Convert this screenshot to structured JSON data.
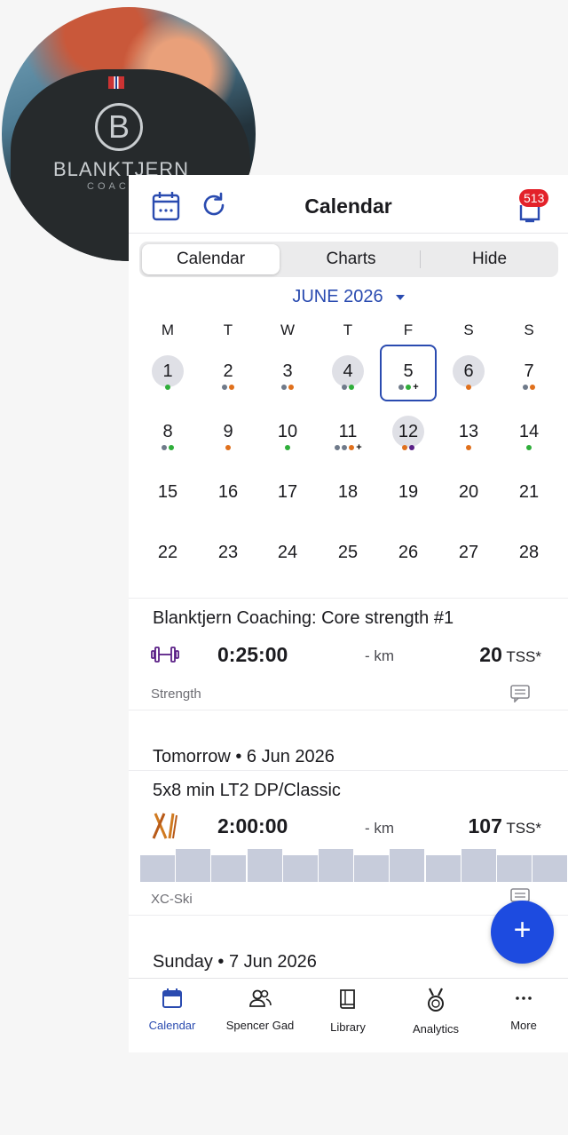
{
  "photo": {
    "brand": "BLANKTJERN",
    "brand_sub": "COACHING",
    "logo_letter": "B"
  },
  "header": {
    "title": "Calendar",
    "notification_count": "513",
    "icons": [
      "calendar-icon",
      "refresh-icon",
      "tray-icon"
    ]
  },
  "segments": [
    {
      "label": "Calendar",
      "active": true
    },
    {
      "label": "Charts",
      "active": false
    },
    {
      "label": "Hide",
      "active": false
    }
  ],
  "month": {
    "label": "JUNE 2026"
  },
  "weekdays": [
    "M",
    "T",
    "W",
    "T",
    "F",
    "S",
    "S"
  ],
  "dot_colors": {
    "gray": "#6f7a8a",
    "green": "#2fae3a",
    "orange": "#e0701c",
    "purple": "#5a1f86"
  },
  "weeks": [
    [
      {
        "d": "1",
        "sel": true,
        "dots": [
          "green"
        ]
      },
      {
        "d": "2",
        "dots": [
          "gray",
          "orange"
        ]
      },
      {
        "d": "3",
        "dots": [
          "gray",
          "orange"
        ]
      },
      {
        "d": "4",
        "sel": true,
        "dots": [
          "gray",
          "green"
        ]
      },
      {
        "d": "5",
        "today": true,
        "dots": [
          "gray",
          "green"
        ],
        "plus": true
      },
      {
        "d": "6",
        "sel": true,
        "dots": [
          "orange"
        ]
      },
      {
        "d": "7",
        "dots": [
          "gray",
          "orange"
        ]
      }
    ],
    [
      {
        "d": "8",
        "dots": [
          "gray",
          "green"
        ]
      },
      {
        "d": "9",
        "dots": [
          "orange"
        ]
      },
      {
        "d": "10",
        "dots": [
          "green"
        ]
      },
      {
        "d": "11",
        "dots": [
          "gray",
          "gray",
          "orange"
        ],
        "plus": true
      },
      {
        "d": "12",
        "sel": true,
        "dots": [
          "orange",
          "purple"
        ]
      },
      {
        "d": "13",
        "dots": [
          "orange"
        ]
      },
      {
        "d": "14",
        "dots": [
          "green"
        ]
      }
    ],
    [
      {
        "d": "15"
      },
      {
        "d": "16"
      },
      {
        "d": "17"
      },
      {
        "d": "18"
      },
      {
        "d": "19"
      },
      {
        "d": "20"
      },
      {
        "d": "21"
      }
    ],
    [
      {
        "d": "22"
      },
      {
        "d": "23"
      },
      {
        "d": "24"
      },
      {
        "d": "25"
      },
      {
        "d": "26"
      },
      {
        "d": "27"
      },
      {
        "d": "28"
      }
    ]
  ],
  "workout1": {
    "title": "Blanktjern Coaching: Core strength #1",
    "duration": "0:25:00",
    "km": "- km",
    "tss_value": "20",
    "tss_unit": "TSS*",
    "type": "Strength"
  },
  "day2_label": "Tomorrow • 6 Jun 2026",
  "workout2": {
    "title": "5x8 min LT2 DP/Classic",
    "duration": "2:00:00",
    "km": "- km",
    "tss_value": "107",
    "tss_unit": "TSS*",
    "type": "XC-Ski",
    "intensity_profile": [
      0.78,
      0.97,
      0.78,
      0.97,
      0.78,
      0.97,
      0.78,
      0.97,
      0.78,
      0.97,
      0.78,
      0.78
    ]
  },
  "day3_label": "Sunday • 7 Jun 2026",
  "fab_label": "+",
  "tabs": [
    {
      "label": "Calendar",
      "icon": "calendar-icon",
      "active": true
    },
    {
      "label": "Spencer Gad",
      "icon": "athletes-icon"
    },
    {
      "label": "Library",
      "icon": "book-icon"
    },
    {
      "label": "Analytics",
      "icon": "medal-icon"
    },
    {
      "label": "More",
      "icon": "more-icon"
    }
  ]
}
